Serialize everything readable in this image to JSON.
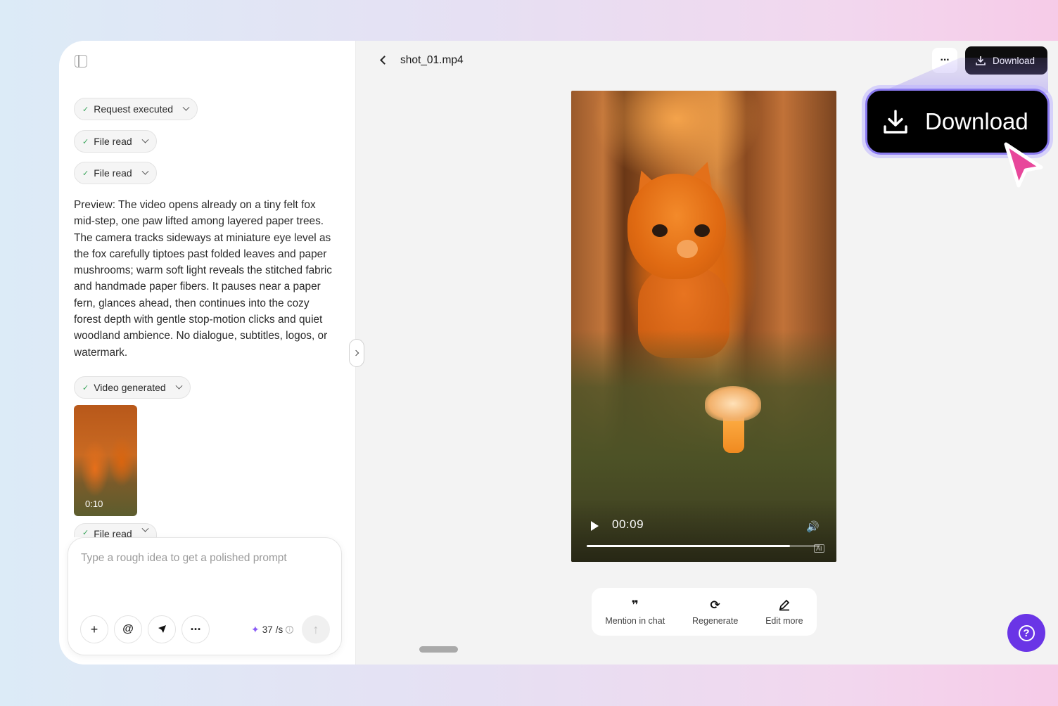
{
  "chips": {
    "request_executed": "Request executed",
    "file_read_1": "File read",
    "file_read_2": "File read",
    "video_generated": "Video generated",
    "file_read_3": "File read"
  },
  "preview_text": "Preview: The video opens already on a tiny felt fox mid-step, one paw lifted among layered paper trees. The camera tracks sideways at miniature eye level as the fox carefully tiptoes past folded leaves and paper mushrooms; warm soft light reveals the stitched fabric and handmade paper fibers. It pauses near a paper fern, glances ahead, then continues into the cozy forest depth with gentle stop-motion clicks and quiet woodland ambience. No dialogue, subtitles, logos, or watermark.",
  "thumbnail": {
    "duration": "0:10"
  },
  "composer": {
    "placeholder": "Type a rough idea to get a polished prompt",
    "cost_value": "37",
    "cost_unit": "/s"
  },
  "header": {
    "file_title": "shot_01.mp4",
    "download_label": "Download"
  },
  "video": {
    "current_time": "00:09",
    "progress": 0.87,
    "ai_badge": "AI"
  },
  "actions": {
    "mention": "Mention in chat",
    "regenerate": "Regenerate",
    "edit_more": "Edit more"
  },
  "zoom_callout": {
    "label": "Download"
  },
  "colors": {
    "accent": "#6a35e6",
    "cursor": "#e8479b",
    "callout_border": "#8b7bf0"
  }
}
